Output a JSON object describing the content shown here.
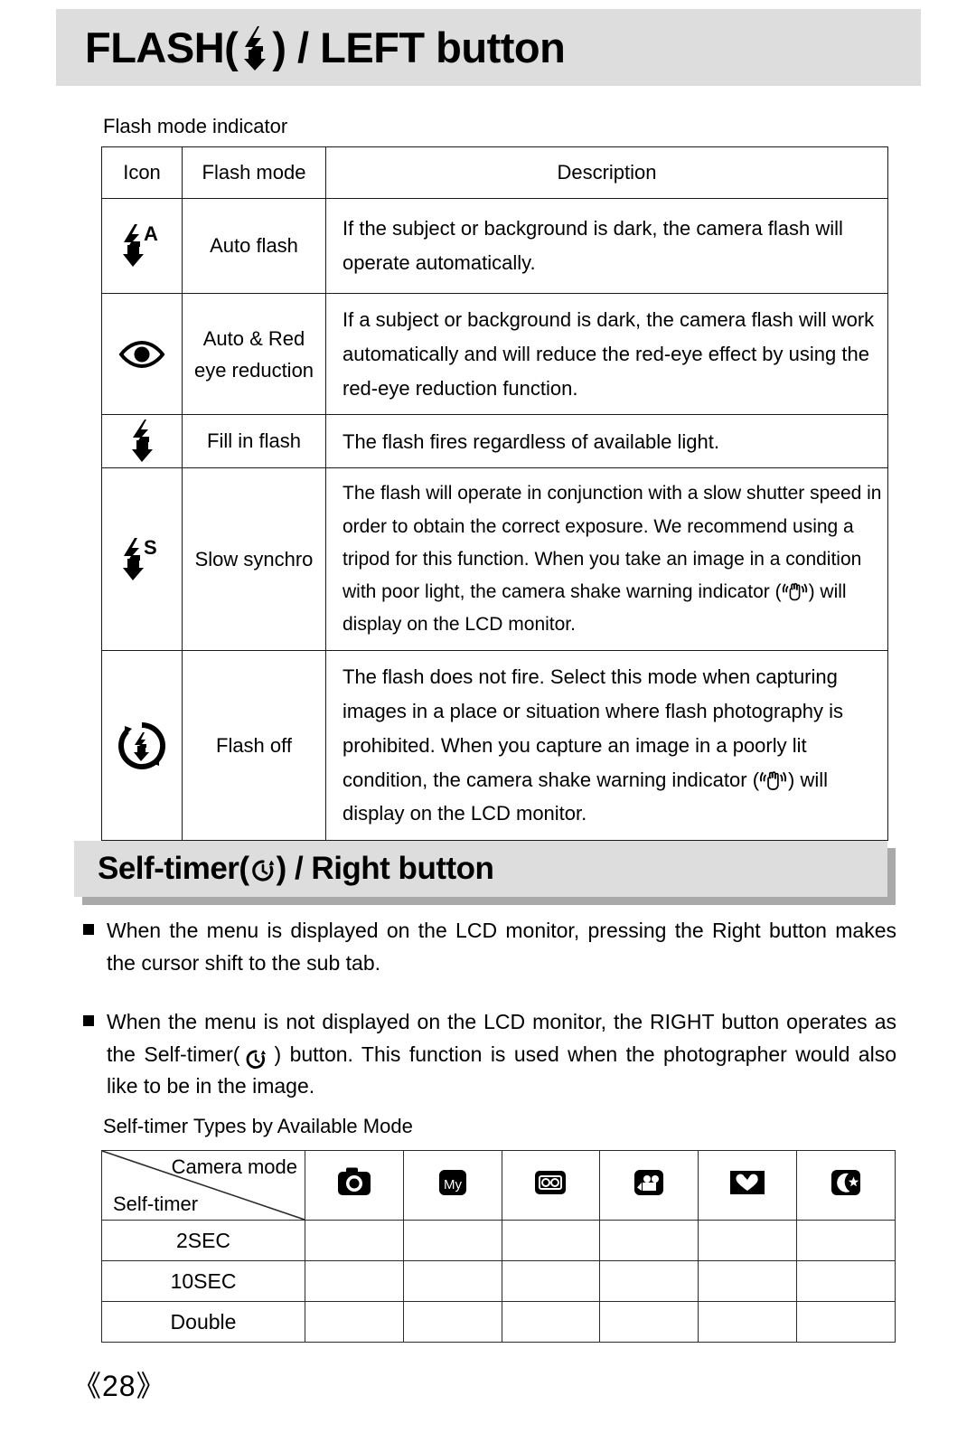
{
  "header": {
    "title_prefix": "FLASH(",
    "title_suffix": ") / LEFT button",
    "icon": "flash-bolt-icon"
  },
  "flash_section": {
    "caption": "Flash mode indicator",
    "table": {
      "headers": [
        "Icon",
        "Flash mode",
        "Description"
      ],
      "rows": [
        {
          "icon": "flash-auto-icon",
          "mode": "Auto flash",
          "description": "If the subject or background is dark, the camera flash will operate automatically."
        },
        {
          "icon": "red-eye-reduction-icon",
          "mode_line1": "Auto & Red",
          "mode_line2": "eye reduction",
          "description": "If a subject or background is dark, the camera flash will work automatically and will reduce the red-eye effect by using the red-eye reduction function."
        },
        {
          "icon": "fill-in-flash-icon",
          "mode": "Fill in flash",
          "description": "The flash fires regardless of available light."
        },
        {
          "icon": "slow-synchro-icon",
          "mode": "Slow synchro",
          "description_part1": "The flash will operate in conjunction with a slow shutter speed in order to obtain the correct exposure. We recommend using a tripod for this function. When you take an image in a condition with poor light, the camera shake warning indicator (",
          "description_part2": ") will display on the LCD monitor."
        },
        {
          "icon": "flash-off-icon",
          "mode": "Flash off",
          "description_part1": "The flash does not fire. Select this mode when capturing images in a place or situation where flash photography is prohibited. When you capture an image in a poorly lit condition, the camera shake warning indicator (",
          "description_part2": ") will display on the LCD monitor."
        }
      ]
    }
  },
  "selftimer_section": {
    "title_prefix": "Self-timer(",
    "title_suffix": ") / Right button",
    "icon": "self-timer-icon",
    "bullets": [
      {
        "text": "When the menu is displayed on the LCD monitor, pressing the Right button makes the cursor shift to the sub tab."
      },
      {
        "text_part1": "When the menu is not displayed on the LCD monitor, the RIGHT button operates as the Self-timer(",
        "text_part2": ") button. This function is used when the photographer would also like to be in the image."
      }
    ],
    "caption": "Self-timer Types by Available Mode",
    "table": {
      "corner_top": "Camera mode",
      "corner_bottom": "Self-timer",
      "mode_icons": [
        "auto-camera-mode-icon",
        "my-set-mode-icon",
        "voice-recording-mode-icon",
        "movie-clip-mode-icon",
        "portrait-mode-icon",
        "night-scene-mode-icon"
      ],
      "mode_icon_labels": [
        "",
        "My",
        "",
        "",
        "",
        ""
      ],
      "row_labels": [
        "2SEC",
        "10SEC",
        "Double"
      ],
      "cells": [
        [
          "",
          "",
          "",
          "",
          "",
          ""
        ],
        [
          "",
          "",
          "",
          "",
          "",
          ""
        ],
        [
          "",
          "",
          "",
          "",
          "",
          ""
        ]
      ]
    }
  },
  "footer": {
    "page_number": "《28》"
  },
  "colors": {
    "band_background": "#dddddd",
    "band_shadow": "#a9a9a9",
    "text": "#000000",
    "table_border": "#1a1a1a"
  }
}
